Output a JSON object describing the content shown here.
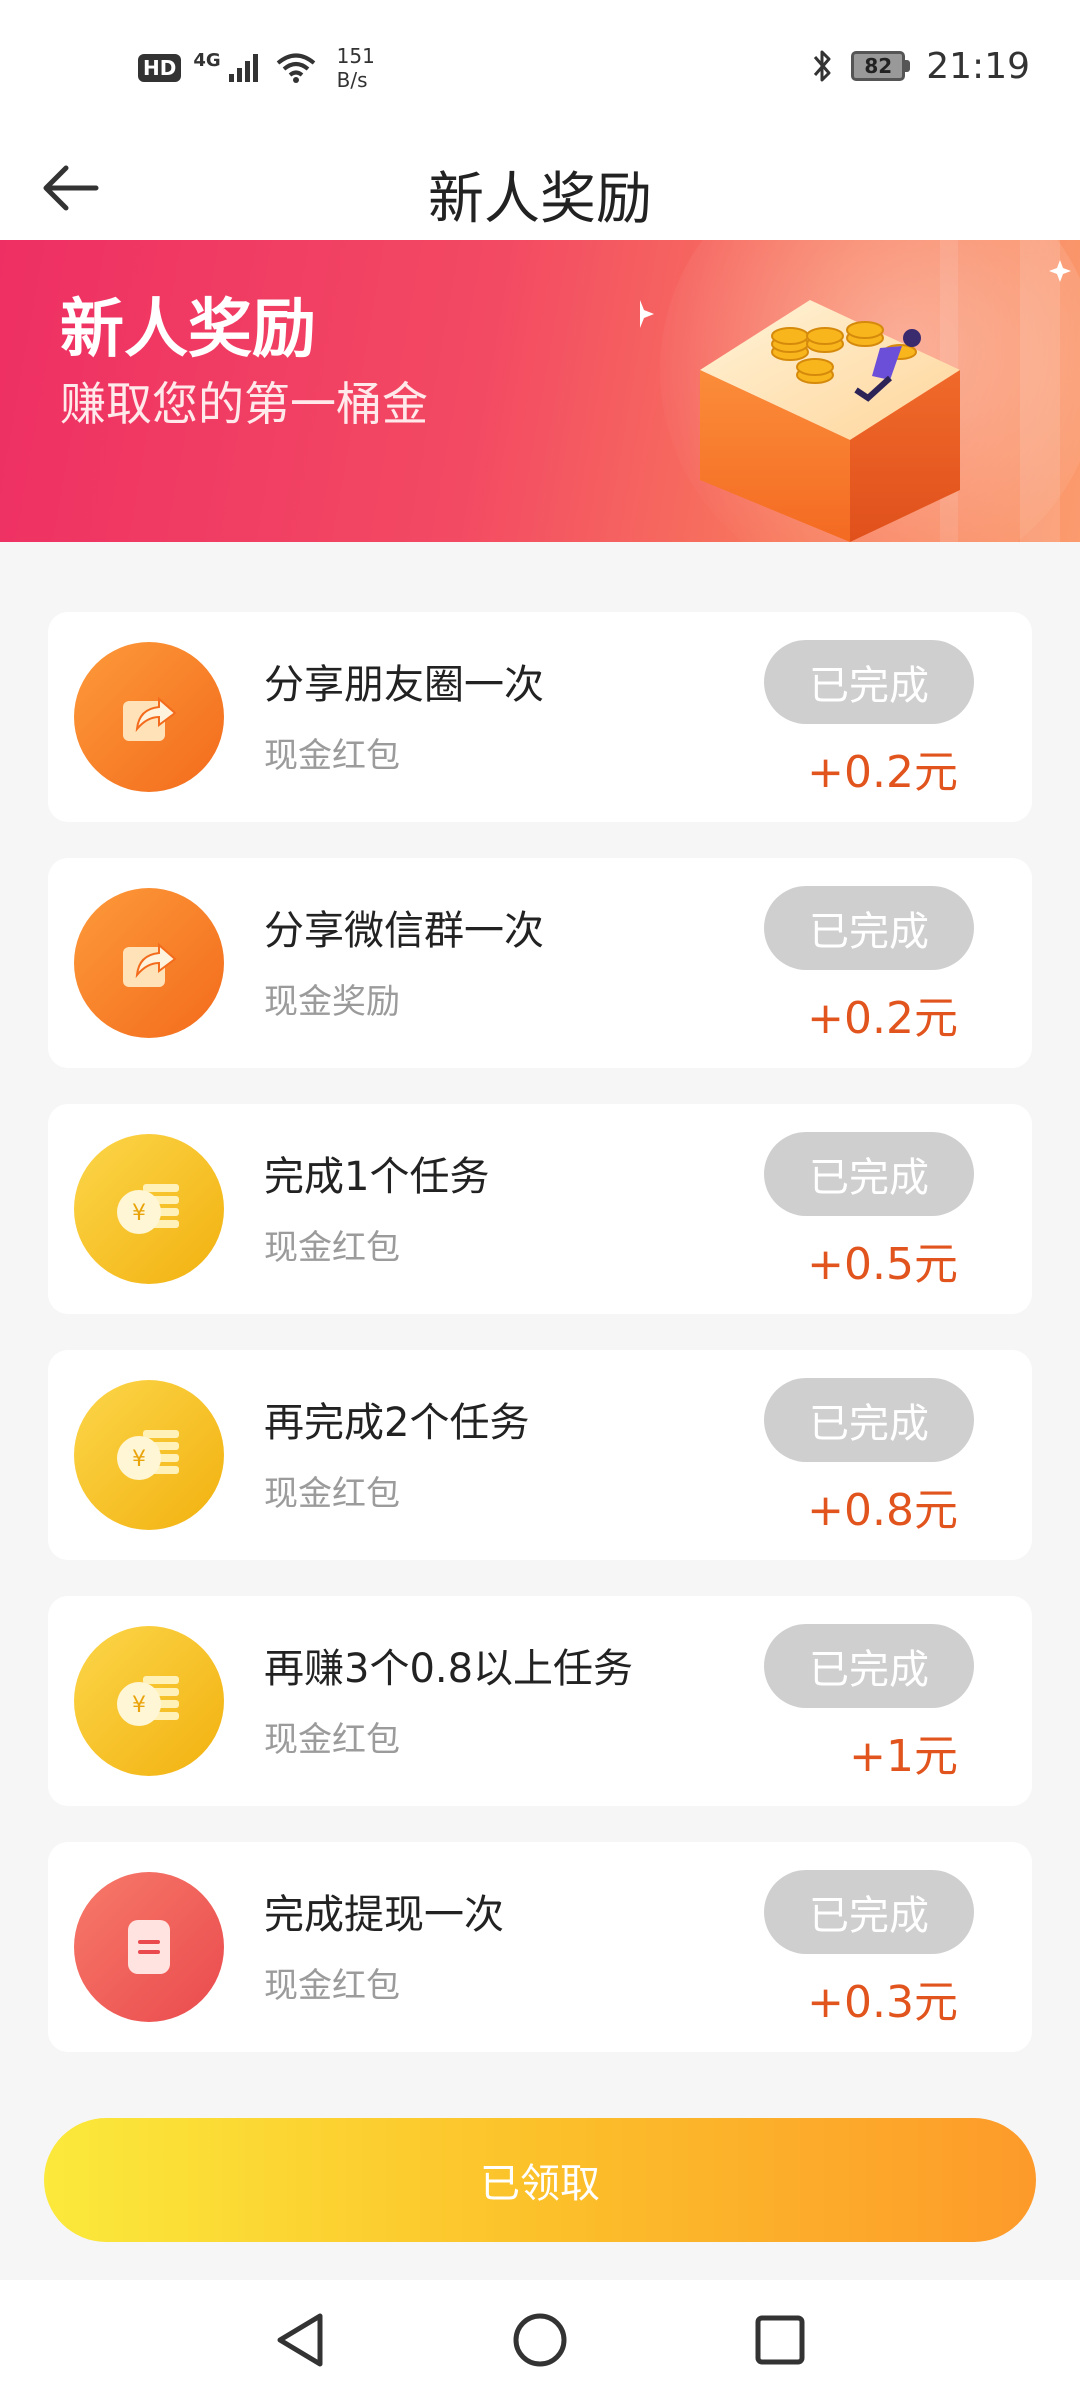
{
  "status_bar": {
    "hd": "HD",
    "network": "4G",
    "speed_value": "151",
    "speed_unit": "B/s",
    "battery": "82",
    "time": "21:19"
  },
  "header": {
    "title": "新人奖励"
  },
  "banner": {
    "title": "新人奖励",
    "subtitle": "赚取您的第一桶金"
  },
  "tasks": [
    {
      "title": "分享朋友圈一次",
      "sub": "现金红包",
      "status": "已完成",
      "reward": "+0.2元",
      "icon": "share-icon"
    },
    {
      "title": "分享微信群一次",
      "sub": "现金奖励",
      "status": "已完成",
      "reward": "+0.2元",
      "icon": "share-icon"
    },
    {
      "title": "完成1个任务",
      "sub": "现金红包",
      "status": "已完成",
      "reward": "+0.5元",
      "icon": "coin-icon"
    },
    {
      "title": "再完成2个任务",
      "sub": "现金红包",
      "status": "已完成",
      "reward": "+0.8元",
      "icon": "coin-icon"
    },
    {
      "title": "再赚3个0.8以上任务",
      "sub": "现金红包",
      "status": "已完成",
      "reward": "+1元",
      "icon": "coin-icon"
    },
    {
      "title": "完成提现一次",
      "sub": "现金红包",
      "status": "已完成",
      "reward": "+0.3元",
      "icon": "withdraw-icon"
    }
  ],
  "claim_button": {
    "label": "已领取"
  },
  "colors": {
    "accent": "#e2541d",
    "banner_start": "#ee2f63",
    "banner_end": "#fb9b6e",
    "pill_done": "#cfcfcf",
    "claim_start": "#fbe93b",
    "claim_end": "#fd9a2a"
  }
}
